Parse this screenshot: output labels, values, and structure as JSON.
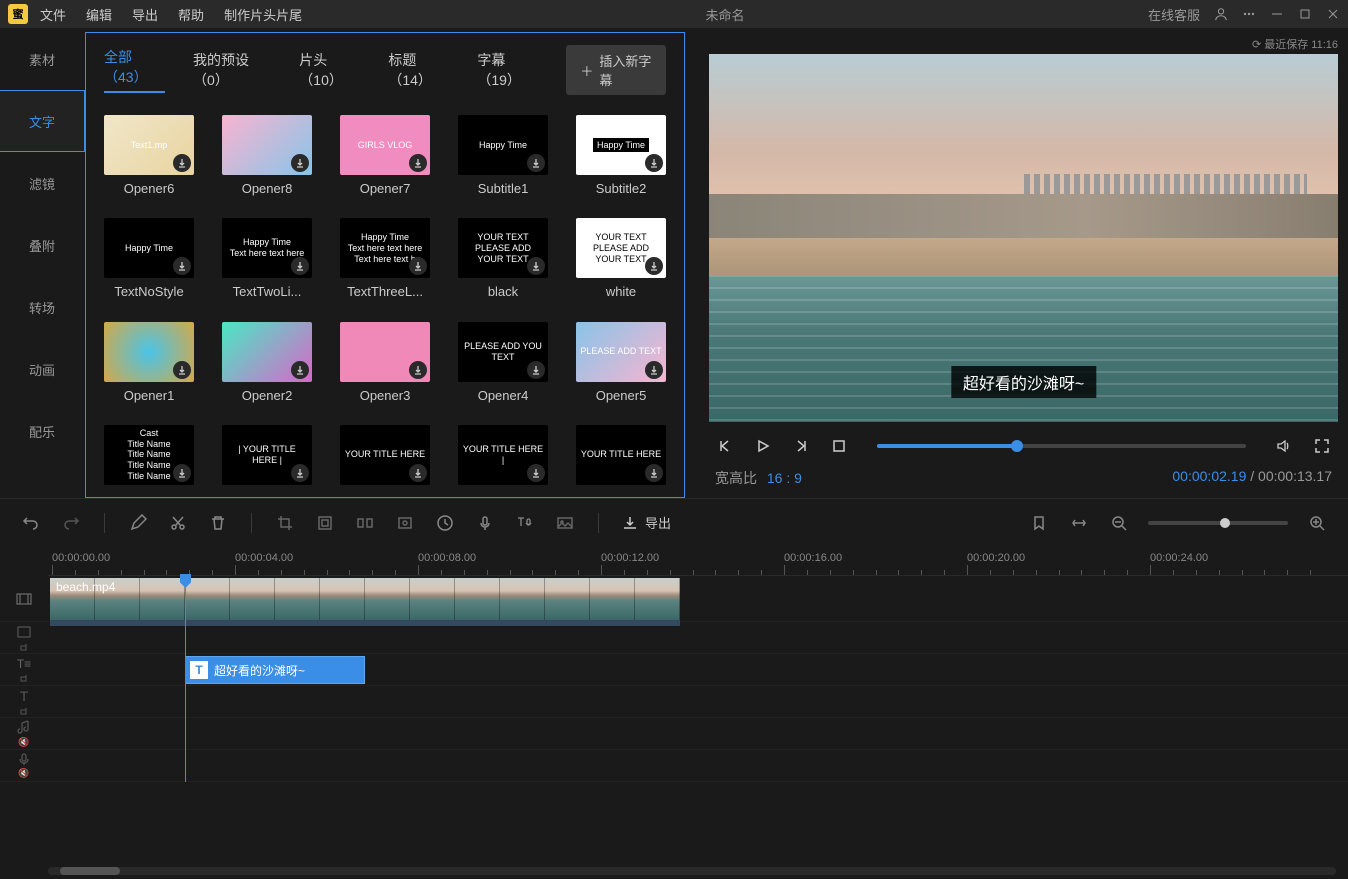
{
  "titlebar": {
    "menus": [
      "文件",
      "编辑",
      "导出",
      "帮助",
      "制作片头片尾"
    ],
    "title": "未命名",
    "online_service": "在线客服",
    "saved": "最近保存 11:16"
  },
  "sidebar": {
    "items": [
      "素材",
      "文字",
      "滤镜",
      "叠附",
      "转场",
      "动画",
      "配乐"
    ],
    "active": 1
  },
  "asset_tabs": {
    "tabs": [
      {
        "label": "全部（43）",
        "active": true
      },
      {
        "label": "我的预设（0）"
      },
      {
        "label": "片头（10）"
      },
      {
        "label": "标题（14）"
      },
      {
        "label": "字幕（19）"
      }
    ],
    "new_subtitle_btn": "插入新字幕"
  },
  "assets": [
    {
      "label": "Opener6",
      "bg": "linear-gradient(135deg,#f0e6c8,#e8d4a0)",
      "text": "Text1.mp"
    },
    {
      "label": "Opener8",
      "bg": "linear-gradient(135deg,#f8b4d0,#88c4e8)",
      "text": ""
    },
    {
      "label": "Opener7",
      "bg": "#f08cc0",
      "text": "GIRLS VLOG"
    },
    {
      "label": "Subtitle1",
      "bg": "#000",
      "text": "Happy Time"
    },
    {
      "label": "Subtitle2",
      "bg": "#fff",
      "text": "Happy Time",
      "txtcolor": "#000",
      "txtbg": "#000",
      "txtc": "#fff"
    },
    {
      "label": "TextNoStyle",
      "bg": "#000",
      "text": "Happy Time"
    },
    {
      "label": "TextTwoLi...",
      "bg": "#000",
      "text": "Happy Time\nText here text here"
    },
    {
      "label": "TextThreeL...",
      "bg": "#000",
      "text": "Happy Time\nText here text here\nText here text h"
    },
    {
      "label": "black",
      "bg": "#000",
      "text": "YOUR TEXT\nPLEASE ADD YOUR TEXT"
    },
    {
      "label": "white",
      "bg": "#fff",
      "text": "YOUR TEXT\nPLEASE ADD YOUR TEXT",
      "txtcolor": "#000"
    },
    {
      "label": "Opener1",
      "bg": "radial-gradient(circle,#4ac4e8,#d4a848)",
      "text": ""
    },
    {
      "label": "Opener2",
      "bg": "linear-gradient(135deg,#48e8c4,#d868c8)",
      "text": ""
    },
    {
      "label": "Opener3",
      "bg": "#f088b8",
      "text": ""
    },
    {
      "label": "Opener4",
      "bg": "#000",
      "text": "PLEASE ADD YOU TEXT"
    },
    {
      "label": "Opener5",
      "bg": "linear-gradient(135deg,#88c4e8,#f8b4d0)",
      "text": "PLEASE ADD TEXT"
    },
    {
      "label": "",
      "bg": "#000",
      "text": "Cast\nTitle Name\nTitle Name\nTitle Name\nTitle Name"
    },
    {
      "label": "",
      "bg": "#000",
      "text": "| YOUR TITLE HERE |"
    },
    {
      "label": "",
      "bg": "#000",
      "text": "YOUR TITLE HERE",
      "accent": "#48e8c4"
    },
    {
      "label": "",
      "bg": "#000",
      "text": "YOUR TITLE HERE |"
    },
    {
      "label": "",
      "bg": "#000",
      "text": "YOUR TITLE HERE",
      "accent": "#48e8c4"
    }
  ],
  "preview": {
    "subtitle": "超好看的沙滩呀~",
    "aspect_label": "宽高比",
    "aspect_value": "16 : 9",
    "time_current": "00:00:02.19",
    "time_total": "00:00:13.17"
  },
  "toolbar": {
    "export": "导出"
  },
  "timeline": {
    "marks": [
      "00:00:00.00",
      "00:00:04.00",
      "00:00:08.00",
      "00:00:12.00",
      "00:00:16.00",
      "00:00:20.00",
      "00:00:24.00"
    ],
    "video_clip": "beach.mp4",
    "text_clip": "超好看的沙滩呀~"
  }
}
